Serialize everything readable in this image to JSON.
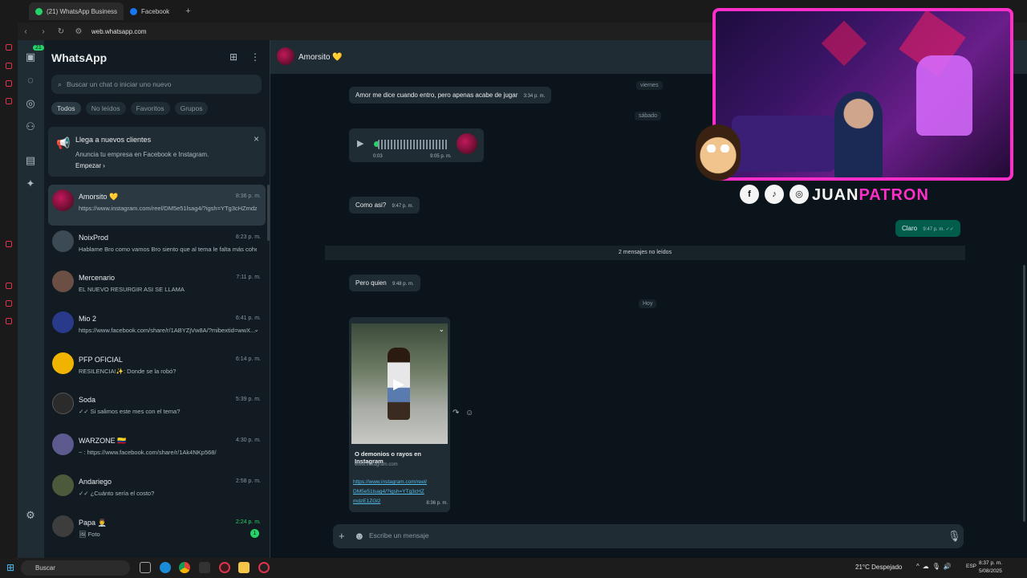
{
  "browser": {
    "tabs": [
      {
        "label": "(21) WhatsApp Business",
        "active": true
      },
      {
        "label": "Facebook",
        "active": false
      }
    ],
    "new_tab": "+",
    "url_host": "web.whatsapp.com"
  },
  "nav": {
    "badge": "21"
  },
  "sidebar": {
    "title": "WhatsApp",
    "search_placeholder": "Buscar un chat o iniciar uno nuevo",
    "filters": [
      "Todos",
      "No leídos",
      "Favoritos",
      "Grupos"
    ],
    "promo": {
      "title": "Llega a nuevos clientes",
      "subtitle": "Anuncia tu empresa en Facebook e Instagram.",
      "cta": "Empezar ›",
      "close": "×"
    },
    "chats": [
      {
        "name": "Amorsito 💛",
        "time": "8:36 p. m.",
        "preview": "https://www.instagram.com/reel/DM5e51lsag4/?igsh=YTg3cHZmdzE...",
        "color": "#7a1236"
      },
      {
        "name": "NoixProd",
        "time": "8:23 p. m.",
        "preview": "Hablame Bro como vamos  Bro siento que al tema le falta más cohes...",
        "color": "#3b4a54"
      },
      {
        "name": "Mercenario",
        "time": "7:11 p. m.",
        "preview": "EL NUEVO RESURGIR  ASI SE LLAMA",
        "color": "#6b4f45"
      },
      {
        "name": "Mio 2",
        "time": "6:41 p. m.",
        "preview": "https://www.facebook.com/share/r/1ABYZjVw8A/?mibextid=wwX...",
        "color": "#2a3a8a"
      },
      {
        "name": "PFP OFICIAL",
        "time": "6:14 p. m.",
        "preview": "RESILENCIA!✨: Donde se la robó?",
        "color": "#f0b400"
      },
      {
        "name": "Soda",
        "time": "5:39 p. m.",
        "preview": "✓✓ Si salimos este mes con el tema?",
        "color": "#2b2b2b"
      },
      {
        "name": "WARZONE 🇨🇴",
        "time": "4:30 p. m.",
        "preview": "~ : https://www.facebook.com/share/r/1Ak4NKp568/",
        "color": "#5c5a8f"
      },
      {
        "name": "Andariego",
        "time": "2:58 p. m.",
        "preview": "✓✓ ¿Cuánto sería el costo?",
        "color": "#4a5a3a"
      },
      {
        "name": "Papa 👨‍⚕️",
        "time": "2:24 p. m.",
        "preview": "🖼 Foto",
        "color": "#3d3d3d",
        "unread": "1"
      }
    ]
  },
  "conversation": {
    "contact": "Amorsito 💛",
    "days": {
      "friday": "viernes",
      "saturday": "sábado",
      "today": "Hoy"
    },
    "messages": {
      "m1": {
        "text": "Amor me dice cuando entro, pero apenas acabe de jugar",
        "time": "3:34 p. m."
      },
      "voice": {
        "length": "0:03",
        "time": "9:05 p. m."
      },
      "m2": {
        "text": "Como asi?",
        "time": "9:47 p. m."
      },
      "m3": {
        "text": "Claro",
        "time": "9:47 p. m. ✓✓"
      },
      "m4": {
        "text": "Pero quien",
        "time": "9:48 p. m."
      }
    },
    "unread_banner": "2 mensajes no leídos",
    "link_preview": {
      "title": "O demonios o rayos en Instagram",
      "domain": "www.instagram.com",
      "url": "https://www.instagram.com/reel/DM5e51lsag4/?igsh=YTg3cHZmdzE1ZGl2",
      "time": "8:36 p. m."
    },
    "composer_placeholder": "Escribe un mensaje"
  },
  "overlay": {
    "brand_part1": "JUAN",
    "brand_part2": "PATRON",
    "socials": [
      "f",
      "♪",
      "◎"
    ]
  },
  "taskbar": {
    "search": "Buscar",
    "weather": "21°C  Despejado",
    "lang": "ESP",
    "time": "8:37 p. m.",
    "date": "5/08/2025"
  },
  "colors": {
    "accent": "#25d366",
    "panel": "#111b21",
    "bubble_in": "#202c33",
    "bubble_out": "#005c4b",
    "brand_pink": "#ff2ec8"
  }
}
